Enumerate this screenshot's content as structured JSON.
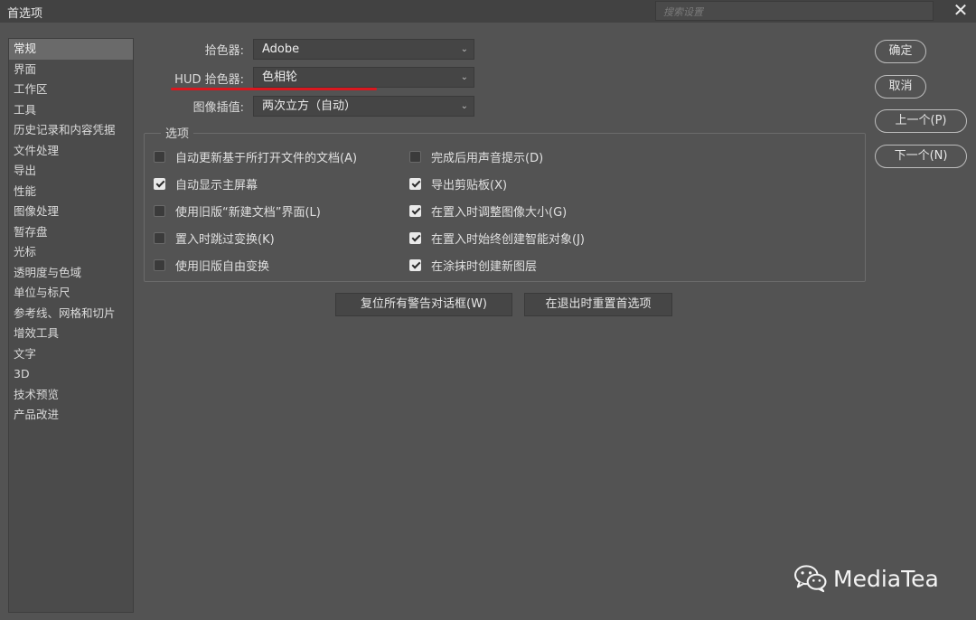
{
  "window": {
    "title": "首选项",
    "search_placeholder": "搜索设置"
  },
  "sidebar": {
    "items": [
      {
        "label": "常规",
        "active": true
      },
      {
        "label": "界面"
      },
      {
        "label": "工作区"
      },
      {
        "label": "工具"
      },
      {
        "label": "历史记录和内容凭据"
      },
      {
        "label": "文件处理"
      },
      {
        "label": "导出"
      },
      {
        "label": "性能"
      },
      {
        "label": "图像处理"
      },
      {
        "label": "暂存盘"
      },
      {
        "label": "光标"
      },
      {
        "label": "透明度与色域"
      },
      {
        "label": "单位与标尺"
      },
      {
        "label": "参考线、网格和切片"
      },
      {
        "label": "增效工具"
      },
      {
        "label": "文字"
      },
      {
        "label": "3D"
      },
      {
        "label": "技术预览"
      },
      {
        "label": "产品改进"
      }
    ]
  },
  "form": {
    "color_picker_label": "拾色器:",
    "color_picker_value": "Adobe",
    "hud_picker_label": "HUD 拾色器:",
    "hud_picker_value": "色相轮",
    "interp_label": "图像插值:",
    "interp_value": "两次立方（自动）"
  },
  "options": {
    "title": "选项",
    "left": [
      {
        "label": "自动更新基于所打开文件的文档(A)",
        "checked": false
      },
      {
        "label": "自动显示主屏幕",
        "checked": true
      },
      {
        "label": "使用旧版“新建文档”界面(L)",
        "checked": false
      },
      {
        "label": "置入时跳过变换(K)",
        "checked": false
      },
      {
        "label": "使用旧版自由变换",
        "checked": false
      }
    ],
    "right": [
      {
        "label": "完成后用声音提示(D)",
        "checked": false
      },
      {
        "label": "导出剪贴板(X)",
        "checked": true
      },
      {
        "label": "在置入时调整图像大小(G)",
        "checked": true
      },
      {
        "label": "在置入时始终创建智能对象(J)",
        "checked": true
      },
      {
        "label": "在涂抹时创建新图层",
        "checked": true
      }
    ]
  },
  "buttons": {
    "reset_warnings": "复位所有警告对话框(W)",
    "reset_prefs": "在退出时重置首选项",
    "ok": "确定",
    "cancel": "取消",
    "prev": "上一个(P)",
    "next": "下一个(N)"
  },
  "watermark": {
    "text": "MediaTea",
    "icon": "wechat-icon"
  },
  "colors": {
    "annotation": "#d9181f",
    "background": "#535353"
  }
}
